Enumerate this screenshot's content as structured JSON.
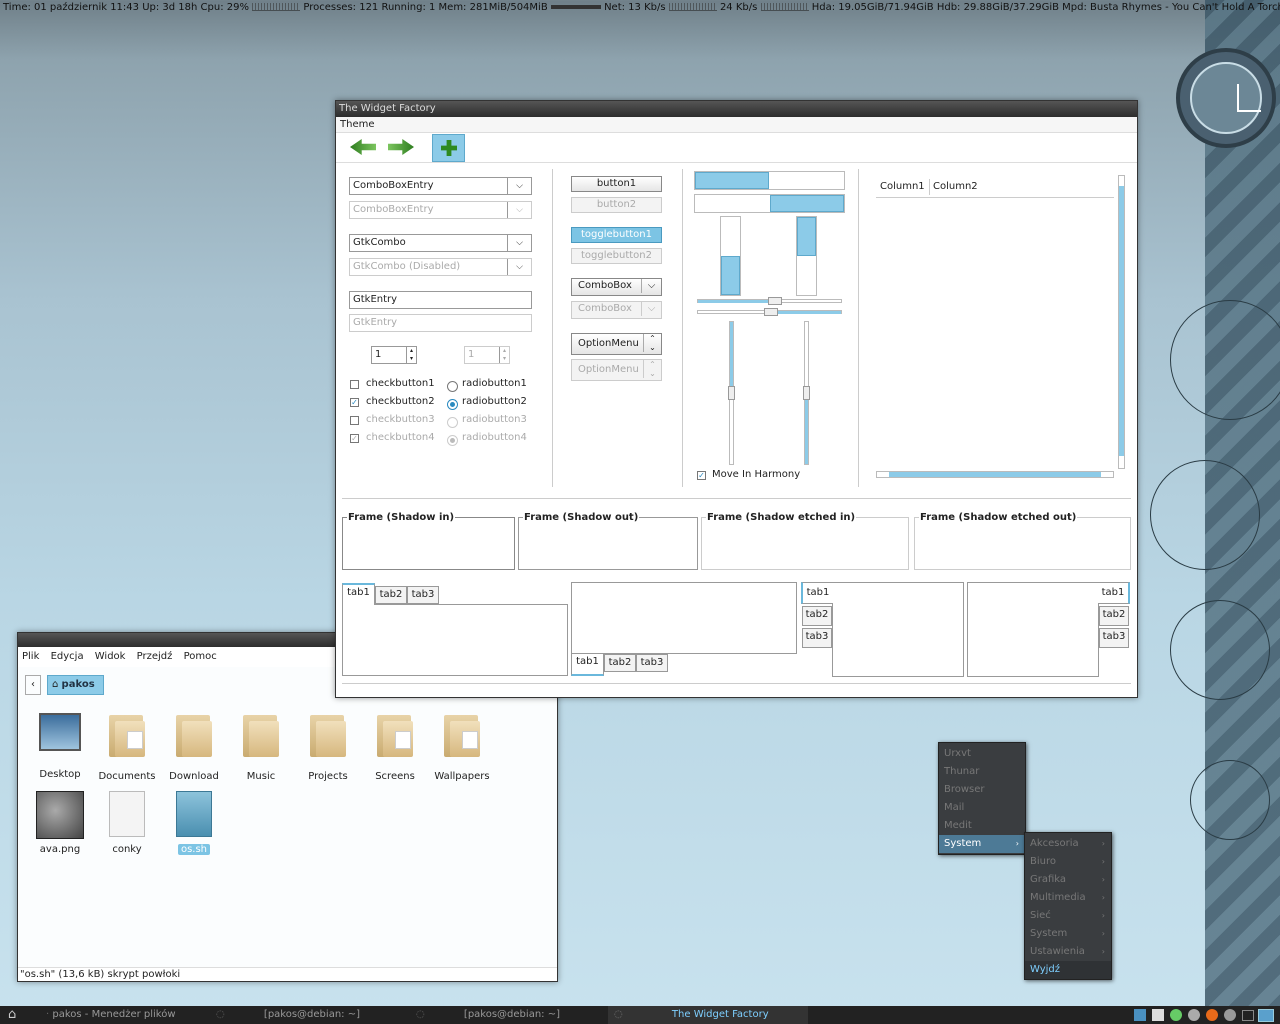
{
  "conky": {
    "text": "Time: 01 październik 11:43  Up: 3d 18h  Cpu: 29%",
    "processes": "Processes: 121  Running: 1  Mem: 281MiB/504MiB",
    "net": "Net: 13 Kb/s",
    "net2": "24 Kb/s",
    "disks": "Hda: 19.05GiB/71.94GiB  Hdb: 29.88GiB/37.29GiB  Mpd:  Busta Rhymes - You Can't Hold A Torch (Fe"
  },
  "widget_factory": {
    "title": "The Widget Factory",
    "menu": [
      "Theme"
    ],
    "combos": {
      "cbe1": "ComboBoxEntry",
      "cbe2": "ComboBoxEntry",
      "gtkcombo": "GtkCombo",
      "gtkcombo_dis": "GtkCombo (Disabled)",
      "entry": "GtkEntry",
      "entry_dis": "GtkEntry",
      "spin1": "1",
      "spin2": "1"
    },
    "checks": [
      "checkbutton1",
      "checkbutton2",
      "checkbutton3",
      "checkbutton4"
    ],
    "radios": [
      "radiobutton1",
      "radiobutton2",
      "radiobutton3",
      "radiobutton4"
    ],
    "buttons": {
      "b1": "button1",
      "b2": "button2",
      "t1": "togglebutton1",
      "t2": "togglebutton2",
      "cb1": "ComboBox",
      "cb2": "ComboBox",
      "om1": "OptionMenu",
      "om2": "OptionMenu"
    },
    "harmony": "Move In Harmony",
    "columns": [
      "Column1",
      "Column2"
    ],
    "frames": [
      "Frame (Shadow in)",
      "Frame (Shadow out)",
      "Frame (Shadow etched in)",
      "Frame (Shadow etched out)"
    ],
    "tabs": [
      "tab1",
      "tab2",
      "tab3"
    ]
  },
  "file_manager": {
    "menu": [
      "Plik",
      "Edycja",
      "Widok",
      "Przejdź",
      "Pomoc"
    ],
    "location": "pakos",
    "items": [
      {
        "name": "Desktop"
      },
      {
        "name": "Documents"
      },
      {
        "name": "Download"
      },
      {
        "name": "Music"
      },
      {
        "name": "Projects"
      },
      {
        "name": "Screens"
      },
      {
        "name": "Wallpapers"
      },
      {
        "name": "ava.png"
      },
      {
        "name": "conky"
      },
      {
        "name": "os.sh"
      }
    ],
    "status": "\"os.sh\" (13,6 kB) skrypt powłoki"
  },
  "menu": {
    "items": [
      "Urxvt",
      "Thunar",
      "Browser",
      "Mail",
      "Medit",
      "System"
    ],
    "submenu": [
      "Akcesoria",
      "Biuro",
      "Grafika",
      "Multimedia",
      "Sieć",
      "System",
      "Ustawienia",
      "Wyjdź"
    ]
  },
  "taskbar": {
    "tasks": [
      "pakos - Menedżer plików",
      "[pakos@debian: ~]",
      "[pakos@debian: ~]",
      "The Widget Factory"
    ]
  }
}
